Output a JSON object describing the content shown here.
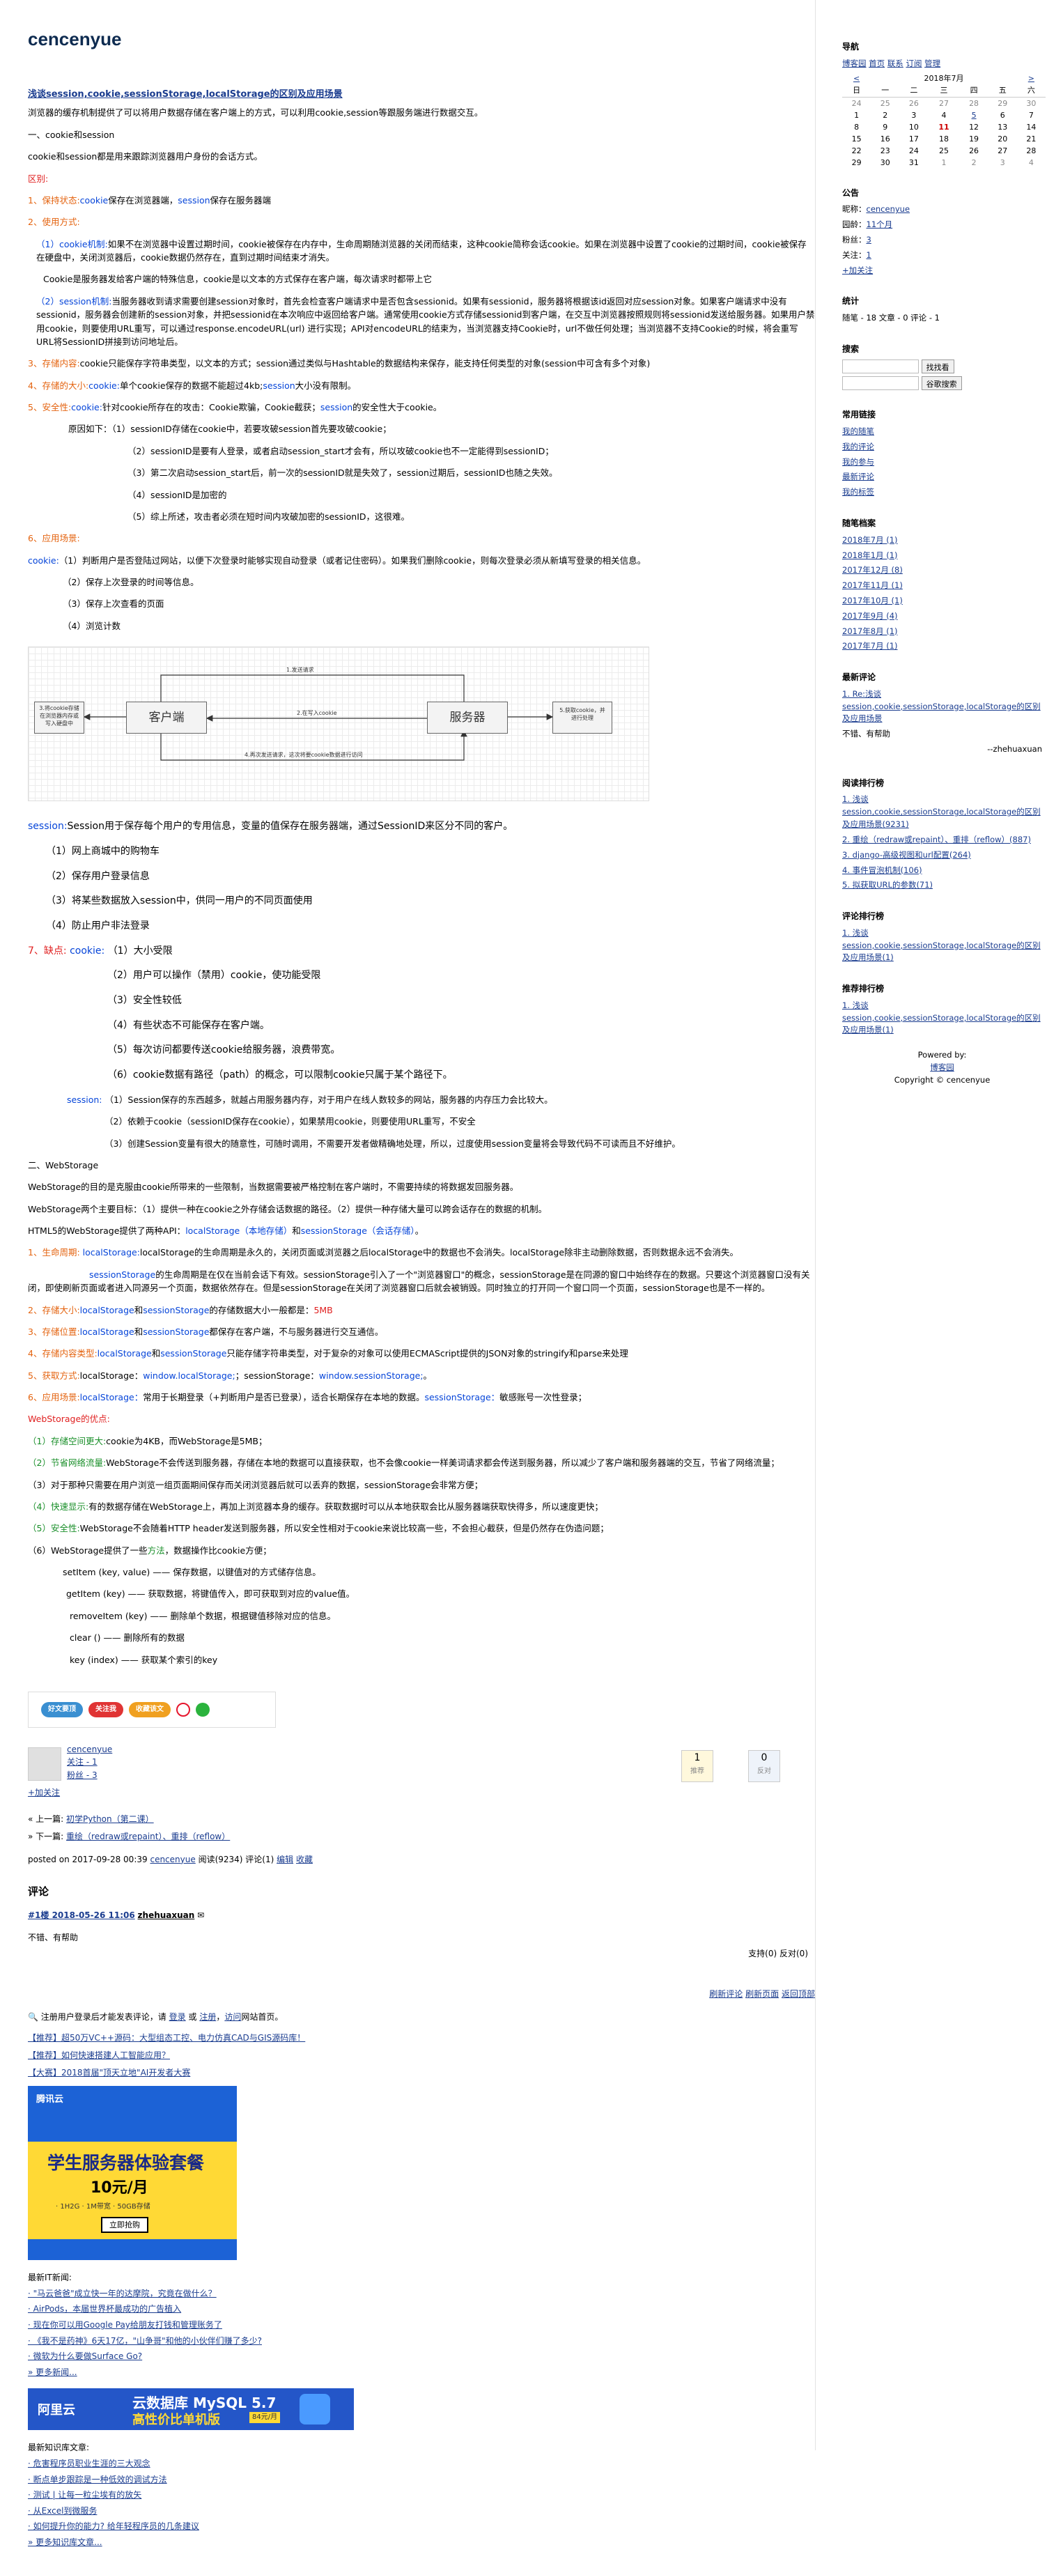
{
  "site_title": "cencenyue",
  "post_title": "浅谈session,cookie,sessionStorage,localStorage的区别及应用场景",
  "intro": "浏览器的缓存机制提供了可以将用户数据存储在客户端上的方式，可以利用cookie,session等跟服务端进行数据交互。",
  "s1_heading": "一、cookie和session",
  "s1_desc": "cookie和session都是用来跟踪浏览器用户身份的会话方式。",
  "diff_label": "区别:",
  "item1_label": "1、保持状态:",
  "item1_t1": "cookie",
  "item1_t2": "保存在浏览器端，",
  "item1_t3": "session",
  "item1_t4": "保存在服务器端",
  "item2_label": "2、使用方式:",
  "item2_c_label": "（1）cookie机制:",
  "item2_c_text": "如果不在浏览器中设置过期时间，cookie被保存在内存中，生命周期随浏览器的关闭而结束，这种cookie简称会话cookie。如果在浏览器中设置了cookie的过期时间，cookie被保存在硬盘中，关闭浏览器后，cookie数据仍然存在，直到过期时间结束才消失。",
  "item2_c_note": "Cookie是服务器发给客户端的特殊信息，cookie是以文本的方式保存在客户端，每次请求时都带上它",
  "item2_s_label": "（2）session机制:",
  "item2_s_text": "当服务器收到请求需要创建session对象时，首先会检查客户端请求中是否包含sessionid。如果有sessionid，服务器将根据该id返回对应session对象。如果客户端请求中没有sessionid，服务器会创建新的session对象，并把sessionid在本次响应中返回给客户端。通常使用cookie方式存储sessionid到客户端，在交互中浏览器按照规则将sessionid发送给服务器。如果用户禁用cookie，则要使用URL重写，可以通过response.encodeURL(url) 进行实现；API对encodeURL的结束为，当浏览器支持Cookie时，url不做任何处理；当浏览器不支持Cookie的时候，将会重写URL将SessionID拼接到访问地址后。",
  "item3_label": "3、存储内容:",
  "item3_text": "cookie只能保存字符串类型，以文本的方式；session通过类似与Hashtable的数据结构来保存，能支持任何类型的对象(session中可含有多个对象)",
  "item4_label": "4、存储的大小:",
  "item4_t1": "cookie:",
  "item4_t2": "单个cookie保存的数据不能超过4kb;",
  "item4_t3": "session",
  "item4_t4": "大小没有限制。",
  "item5_label": "5、安全性:",
  "item5_t1": "cookie:",
  "item5_t2": "针对cookie所存在的攻击：Cookie欺骗，Cookie截获；",
  "item5_t3": "session",
  "item5_t4": "的安全性大于cookie。",
  "reasons_heading": "原因如下：（1）sessionID存储在cookie中，若要攻破session首先要攻破cookie；",
  "reasons": [
    "（2）sessionID是要有人登录，或者启动session_start才会有，所以攻破cookie也不一定能得到sessionID；",
    "（3）第二次启动session_start后，前一次的sessionID就是失效了，session过期后，sessionID也随之失效。",
    "（4）sessionID是加密的",
    "（5）综上所述，攻击者必须在短时间内攻破加密的sessionID，这很难。"
  ],
  "item6_label": "6、应用场景:",
  "scene_cookie_label": "cookie:",
  "scene_cookie_1": "（1）判断用户是否登陆过网站，以便下次登录时能够实现自动登录（或者记住密码）。如果我们删除cookie，则每次登录必须从新填写登录的相关信息。",
  "scene_cookie_items": [
    "（2）保存上次登录的时间等信息。",
    "（3）保存上次查看的页面",
    "（4）浏览计数"
  ],
  "diagram": {
    "client": "客户端",
    "server": "服务器",
    "label_request": "1.发送请求",
    "label_set_cookie": "2.在写入cookie",
    "label_next": "4.再次发送请求，这次将要cookie数据进行访问",
    "left_note": "3.将cookie存储在浏览器内存或写入硬盘中",
    "right_note": "5.获取cookie，并进行处理"
  },
  "session_label": "session:",
  "session_intro": "Session用于保存每个用户的专用信息，变量的值保存在服务器端，通过SessionID来区分不同的客户。",
  "session_items": [
    "（1）网上商城中的购物车",
    "（2）保存用户登录信息",
    "（3）将某些数据放入session中，供同一用户的不同页面使用",
    "（4）防止用户非法登录"
  ],
  "item7_label": "7、缺点:",
  "item7_cookie": "cookie:",
  "item7_first": "（1）大小受限",
  "item7_items": [
    "（2）用户可以操作（禁用）cookie，使功能受限",
    "（3）安全性较低",
    "（4）有些状态不可能保存在客户端。",
    "（5）每次访问都要传送cookie给服务器，浪费带宽。",
    "（6）cookie数据有路径（path）的概念，可以限制cookie只属于某个路径下。"
  ],
  "item7_session_label": "session:",
  "item7_s1": "（1）Session保存的东西越多，就越占用服务器内存，对于用户在线人数较多的网站，服务器的内存压力会比较大。",
  "item7_s2": "（2）依赖于cookie（sessionID保存在cookie），如果禁用cookie，则要使用URL重写，不安全",
  "item7_s3": "（3）创建Session变量有很大的随意性，可随时调用，不需要开发者做精确地处理，所以，过度使用session变量将会导致代码不可读而且不好维护。",
  "s2_heading": "二、WebStorage",
  "ws_p1": "WebStorage的目的是克服由cookie所带来的一些限制，当数据需要被严格控制在客户端时，不需要持续的将数据发回服务器。",
  "ws_p2": "WebStorage两个主要目标：（1）提供一种在cookie之外存储会话数据的路径。（2）提供一种存储大量可以跨会话存在的数据的机制。",
  "ws_p3a": "HTML5的WebStorage提供了两种API：",
  "ws_p3b": "localStorage（本地存储）",
  "ws_p3c": "和",
  "ws_p3d": "sessionStorage（会话存储）",
  "ws_p3e": "。",
  "ws1_label": "1、生命周期:",
  "ws1_t1": "localStorage:",
  "ws1_text": "localStorage的生命周期是永久的，关闭页面或浏览器之后localStorage中的数据也不会消失。localStorage除非主动删除数据，否则数据永远不会消失。",
  "ws1_t2": "sessionStorage",
  "ws1_text2": "的生命周期是在仅在当前会话下有效。sessionStorage引入了一个\"浏览器窗口\"的概念，sessionStorage是在同源的窗口中始终存在的数据。只要这个浏览器窗口没有关闭，即使刷新页面或者进入同源另一个页面，数据依然存在。但是sessionStorage在关闭了浏览器窗口后就会被销毁。同时独立的打开同一个窗口同一个页面，sessionStorage也是不一样的。",
  "ws2_label": "2、存储大小:",
  "ws2_t1": "localStorage",
  "ws2_t2": "和",
  "ws2_t3": "sessionStorage",
  "ws2_t4": "的存储数据大小一般都是：",
  "ws2_t5": "5MB",
  "ws3_label": "3、存储位置:",
  "ws3_t1": "localStorage",
  "ws3_t2": "和",
  "ws3_t3": "sessionStorage",
  "ws3_t4": "都保存在客户端，不与服务器进行交互通信。",
  "ws4_label": "4、存储内容类型:",
  "ws4_t1": "localStorage",
  "ws4_t2": "和",
  "ws4_t3": "sessionStorage",
  "ws4_t4": "只能存储字符串类型，对于复杂的对象可以使用ECMAScript提供的JSON对象的stringify和parse来处理",
  "ws5_label": "5、获取方式:",
  "ws5_t1": "localStorage：",
  "ws5_t2": "window.localStorage;",
  "ws5_t3": "；sessionStorage：",
  "ws5_t4": "window.sessionStorage;",
  "ws5_t5": "。",
  "ws6_label": "6、应用场景:",
  "ws6_t1": "localStorage：",
  "ws6_t2": "常用于长期登录（+判断用户是否已登录），适合长期保存在本地的数据。",
  "ws6_t3": "sessionStorage：",
  "ws6_t4": "敏感账号一次性登录；",
  "adv_label": "WebStorage的优点:",
  "adv1_label": "（1）存储空间更大:",
  "adv1_text": "cookie为4KB，而WebStorage是5MB；",
  "adv2_label": "（2）节省网络流量:",
  "adv2_text": "WebStorage不会传送到服务器，存储在本地的数据可以直接获取，也不会像cookie一样美词请求都会传送到服务器，所以减少了客户端和服务器端的交互，节省了网络流量；",
  "adv3": "（3）对于那种只需要在用户浏览一组页面期间保存而关闭浏览器后就可以丢弃的数据，sessionStorage会非常方便；",
  "adv4_label": "（4）快速显示:",
  "adv4_text": "有的数据存储在WebStorage上，再加上浏览器本身的缓存。获取数据时可以从本地获取会比从服务器端获取快得多，所以速度更快；",
  "adv5_label": "（5）安全性:",
  "adv5_text": "WebStorage不会随着HTTP header发送到服务器，所以安全性相对于cookie来说比较高一些，不会担心截获，但是仍然存在伪造问题；",
  "adv6_a": "（6）WebStorage提供了一些",
  "adv6_b": "方法",
  "adv6_c": "，数据操作比cookie方便；",
  "methods": [
    "setItem (key, value) ——  保存数据，以键值对的方式储存信息。",
    "getItem (key) ——  获取数据，将键值传入，即可获取到对应的value值。",
    "removeItem (key) ——  删除单个数据，根据键值移除对应的信息。",
    "clear () ——  删除所有的数据",
    "key (index) ——  获取某个索引的key"
  ],
  "share": {
    "b1": "好文要顶",
    "b2": "关注我",
    "b3": "收藏该文",
    "weibo_icon": "weibo-icon",
    "wechat_icon": "wechat-icon"
  },
  "author": {
    "name": "cencenyue",
    "follow": "关注 - 1",
    "fans": "粉丝 - 3",
    "add": "+加关注"
  },
  "votes": {
    "up": "1",
    "up_label": "推荐",
    "down": "0",
    "down_label": "反对"
  },
  "nav": {
    "prev_label": "« 上一篇:",
    "prev": "初学Python（第二课）",
    "next_label": "» 下一篇:",
    "next": "重绘（redraw或repaint）、重排（reflow）"
  },
  "posted": {
    "prefix": "posted on 2017-09-28 00:39",
    "author": "cencenyue",
    "stats": "阅读(9234) 评论(1)",
    "edit": "编辑",
    "fav": "收藏"
  },
  "comments_heading": "评论",
  "comment": {
    "floor": "#1楼 2018-05-26 11:06",
    "user": "zhehuaxuan",
    "text": "不错、有帮助",
    "support": "支持(0)",
    "oppose": "反对(0)"
  },
  "comment_links": [
    "刷新评论",
    "刷新页面",
    "返回顶部"
  ],
  "login_notice": {
    "t1": "注册用户登录后才能发表评论，请",
    "login": "登录",
    "t2": "或",
    "register": "注册",
    "t3": "，",
    "visit": "访问",
    "t4": "网站首页。"
  },
  "recommends": [
    "【推荐】超50万VC++源码：大型组态工控、电力仿真CAD与GIS源码库！",
    "【推荐】如何快速搭建人工智能应用？",
    "【大赛】2018首届\"顶天立地\"AI开发者大赛"
  ],
  "ad1": {
    "brand": "腾讯云",
    "title": "学生服务器体验套餐",
    "price": "10元/月",
    "specs": "· 1H2G  · 1M带宽  · 50GB存储",
    "cta": "立即抢购"
  },
  "news_heading": "最新IT新闻:",
  "news": [
    "· \"马云爸爸\"成立快一年的达摩院，究竟在做什么？",
    "· AirPods，本届世界杯最成功的广告植入",
    "· 现在你可以用Google Pay给朋友打钱和管理账务了",
    "· 《我不是药神》6天17亿，\"山争哥\"和他的小伙伴们赚了多少?",
    "· 微软为什么要做Surface Go?",
    "» 更多新闻..."
  ],
  "ad2": {
    "brand": "阿里云",
    "title": "云数据库 MySQL 5.7",
    "subtitle": "高性价比单机版",
    "price": "84元/月"
  },
  "kb_heading": "最新知识库文章:",
  "kb": [
    "· 危害程序员职业生涯的三大观念",
    "· 断点单步跟踪是一种低效的调试方法",
    "· 测试 | 让每一粒尘埃有的放矢",
    "· 从Excel到微服务",
    "· 如何提升你的能力? 给年轻程序员的几条建议",
    "» 更多知识库文章..."
  ],
  "sidebar": {
    "nav_heading": "导航",
    "nav_links": [
      "博客园",
      "首页",
      "联系",
      "订阅",
      "管理"
    ],
    "cal_prev": "<",
    "cal_title": "2018年7月",
    "cal_next": ">",
    "cal_week": [
      "日",
      "一",
      "二",
      "三",
      "四",
      "五",
      "六"
    ],
    "cal_rows": [
      [
        "24",
        "25",
        "26",
        "27",
        "28",
        "29",
        "30"
      ],
      [
        "1",
        "2",
        "3",
        "4",
        "5",
        "6",
        "7"
      ],
      [
        "8",
        "9",
        "10",
        "11",
        "12",
        "13",
        "14"
      ],
      [
        "15",
        "16",
        "17",
        "18",
        "19",
        "20",
        "21"
      ],
      [
        "22",
        "23",
        "24",
        "25",
        "26",
        "27",
        "28"
      ],
      [
        "29",
        "30",
        "31",
        "1",
        "2",
        "3",
        "4"
      ]
    ],
    "notice_heading": "公告",
    "nick_label": "昵称：",
    "nick": "cencenyue",
    "age_label": "园龄：",
    "age": "11个月",
    "fans_label": "粉丝：",
    "fans": "3",
    "follow_label": "关注：",
    "follow": "1",
    "add_follow": "+加关注",
    "stats_heading": "统计",
    "stats": "随笔 - 18   文章 - 0   评论 - 1",
    "search_heading": "搜索",
    "search_btn1": "找找看",
    "search_btn2": "谷歌搜索",
    "links_heading": "常用链接",
    "links": [
      "我的随笔",
      "我的评论",
      "我的参与",
      "最新评论",
      "我的标签"
    ],
    "archive_heading": "随笔档案",
    "archive": [
      "2018年7月 (1)",
      "2018年1月 (1)",
      "2017年12月 (8)",
      "2017年11月 (1)",
      "2017年10月 (1)",
      "2017年9月 (4)",
      "2017年8月 (1)",
      "2017年7月 (1)"
    ],
    "recent_heading": "最新评论",
    "recent_link": "1. Re:浅谈session,cookie,sessionStorage,localStorage的区别及应用场景",
    "recent_text": "不错、有帮助",
    "recent_author": "--zhehuaxuan",
    "read_heading": "阅读排行榜",
    "read": [
      "1. 浅谈session,cookie,sessionStorage,localStorage的区别及应用场景(9231)",
      "2. 重绘（redraw或repaint）、重排（reflow）(887)",
      "3. django-高级视图和url配置(264)",
      "4. 事件冒泡机制(106)",
      "5. 拟获取URL的参数(71)"
    ],
    "comment_heading": "评论排行榜",
    "comment_rank": [
      "1. 浅谈session,cookie,sessionStorage,localStorage的区别及应用场景(1)"
    ],
    "recommend_heading": "推荐排行榜",
    "recommend_rank": [
      "1. 浅谈session,cookie,sessionStorage,localStorage的区别及应用场景(1)"
    ],
    "powered": "Powered by:",
    "powered_link": "博客园",
    "copyright": "Copyright © cencenyue"
  },
  "colors": {
    "link": "#1a3c8f",
    "blue": "#0645d9",
    "red": "#e02020",
    "orange": "#e4630f"
  }
}
